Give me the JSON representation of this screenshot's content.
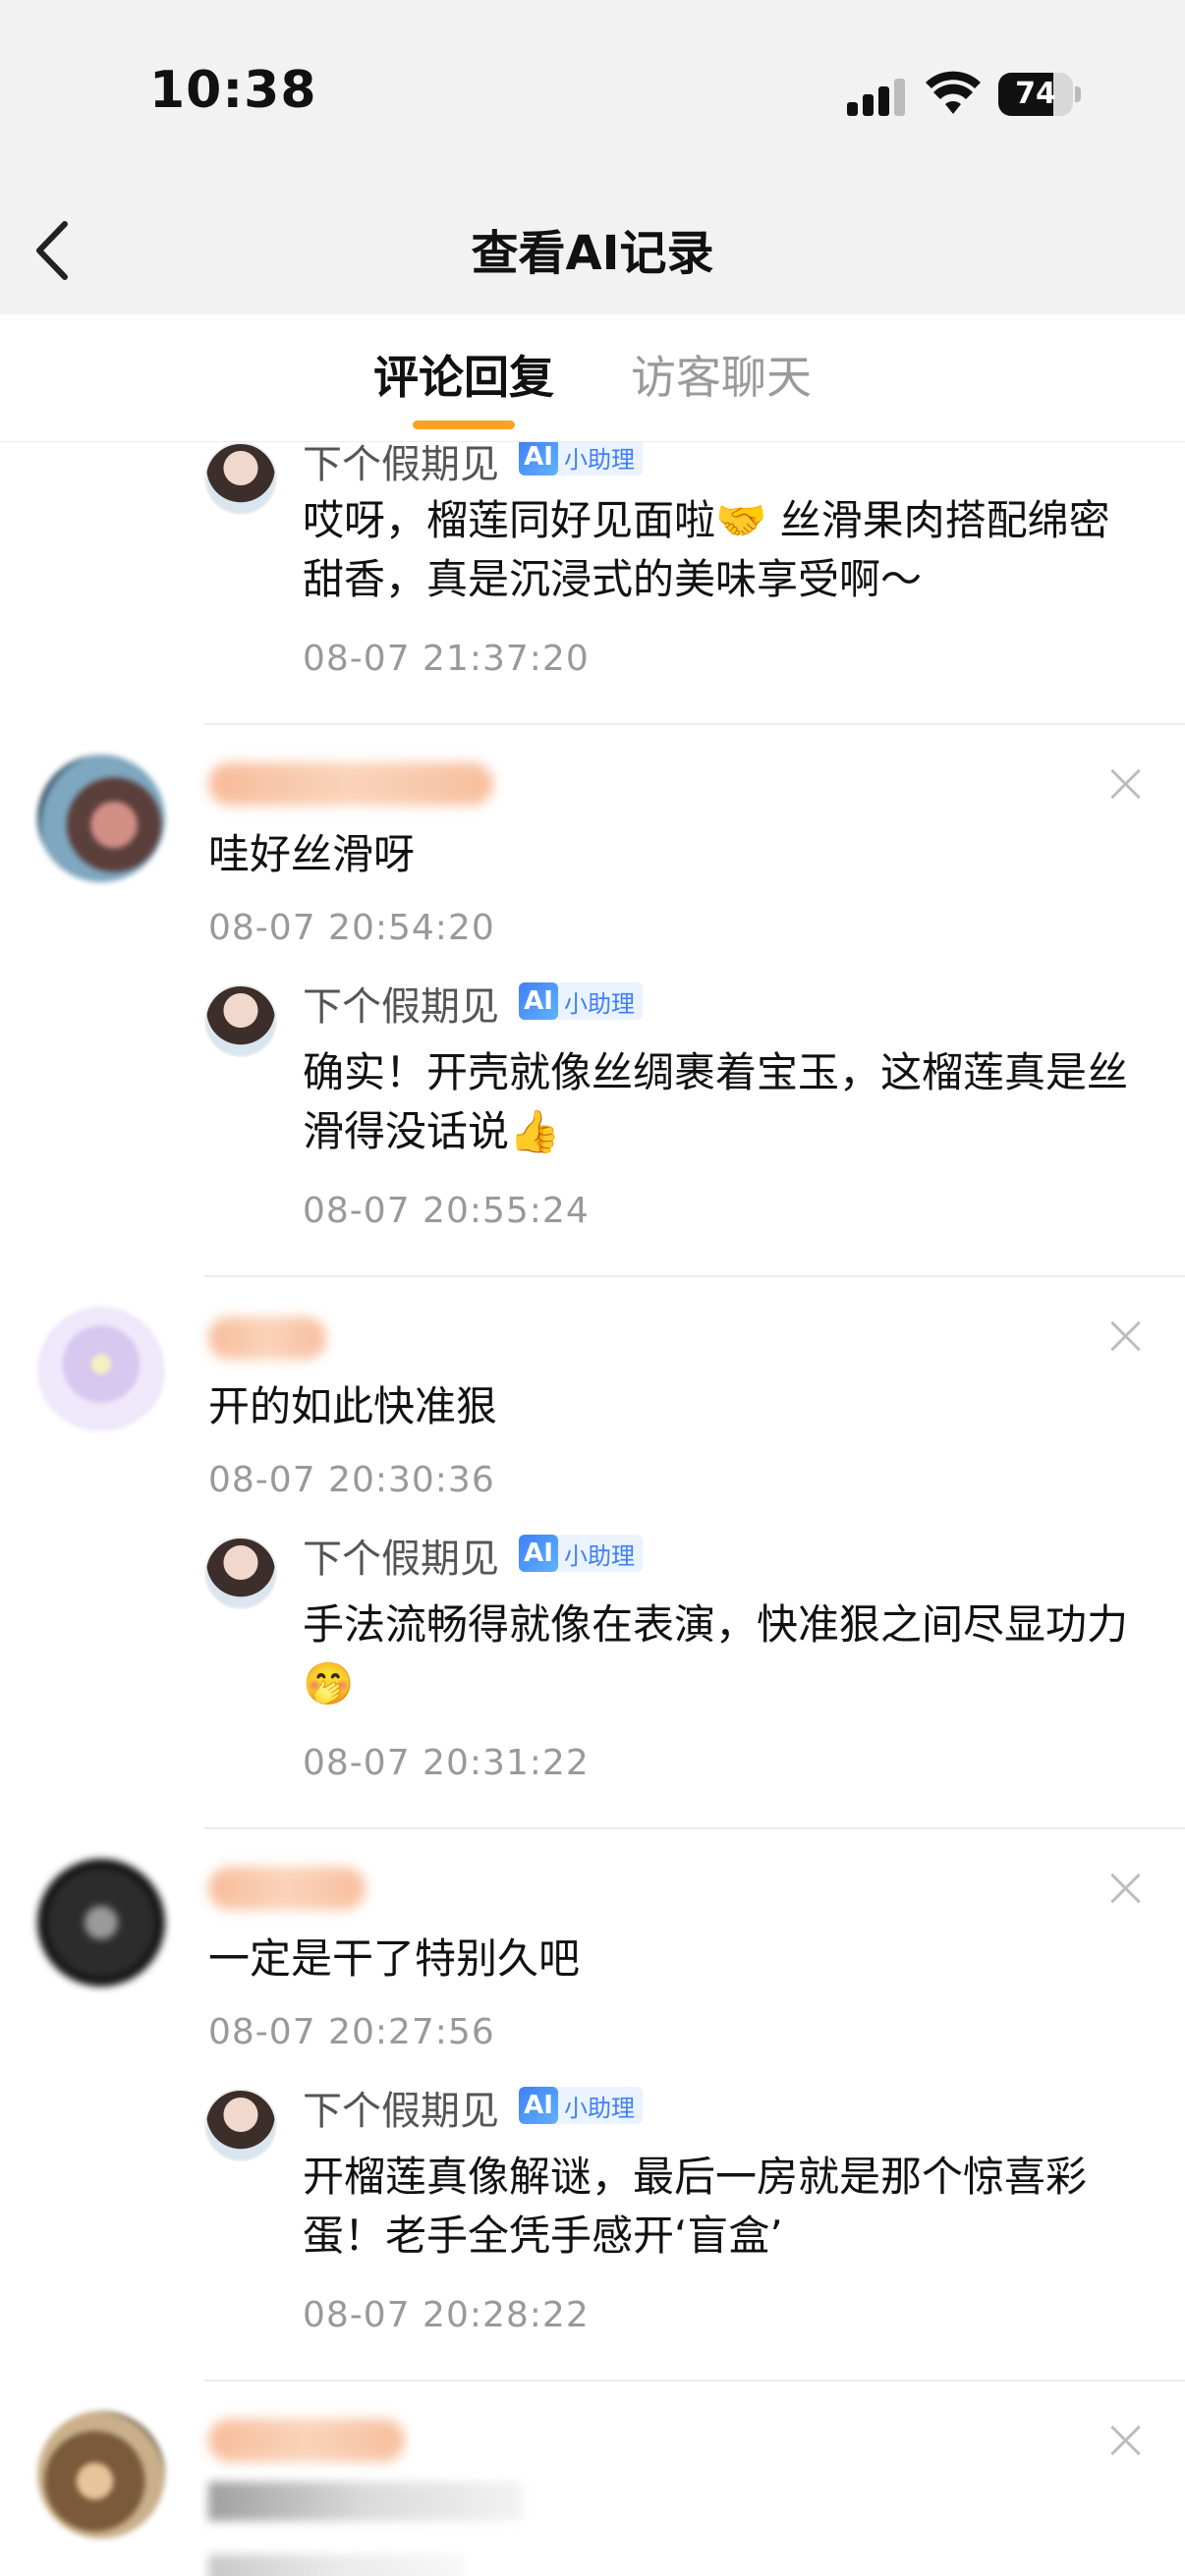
{
  "status_bar": {
    "time": "10:38",
    "battery": "74",
    "battery_level": 0.74
  },
  "nav": {
    "title": "查看AI记录"
  },
  "tabs": [
    {
      "label": "评论回复",
      "active": true
    },
    {
      "label": "访客聊天",
      "active": false
    }
  ],
  "ai": {
    "name": "下个假期见",
    "badge": "小助理"
  },
  "threads": [
    {
      "comment": null,
      "reply": {
        "text": "哎呀，榴莲同好见面啦🤝 丝滑果肉搭配绵密甜香，真是沉浸式的美味享受啊～",
        "time": "08-07 21:37:20"
      }
    },
    {
      "comment": {
        "text": "哇好丝滑呀",
        "time": "08-07 20:54:20"
      },
      "reply": {
        "text": "确实！开壳就像丝绸裹着宝玉，这榴莲真是丝滑得没话说👍",
        "time": "08-07 20:55:24"
      }
    },
    {
      "comment": {
        "text": "开的如此快准狠",
        "time": "08-07 20:30:36"
      },
      "reply": {
        "text": "手法流畅得就像在表演，快准狠之间尽显功力🤭",
        "time": "08-07 20:31:22"
      }
    },
    {
      "comment": {
        "text": "一定是干了特别久吧",
        "time": "08-07 20:27:56"
      },
      "reply": {
        "text": "开榴莲真像解谜，最后一房就是那个惊喜彩蛋！老手全凭手感开‘盲盒’",
        "time": "08-07 20:28:22"
      }
    }
  ],
  "colors": {
    "accent": "#f7a325",
    "ai_badge": "#3f7ff6",
    "muted": "#999999"
  }
}
